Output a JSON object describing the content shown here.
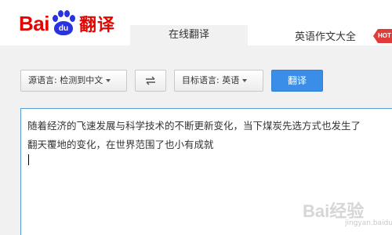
{
  "header": {
    "logo": {
      "bai": "Bai",
      "du": "du",
      "fanyi": "翻译"
    },
    "tab_online": "在线翻译",
    "essay_link": "英语作文大全",
    "hot_badge": "HOT"
  },
  "toolbar": {
    "source_lang": "源语言: 检测到中文",
    "swap_icon": "swap-arrows-icon",
    "target_lang": "目标语言: 英语",
    "translate_label": "翻译"
  },
  "input": {
    "line1": "随着经济的飞速发展与科学技术的不断更新变化，当下煤炭先选方式也发生了",
    "line2": "翻天覆地的变化，在世界范围了也小有成就"
  },
  "watermark": {
    "text": "Bai经验",
    "sub": "jingyan.baidu.com"
  },
  "colors": {
    "brand_red": "#e10602",
    "brand_blue": "#2932e1",
    "button_blue": "#3a8ee8"
  }
}
